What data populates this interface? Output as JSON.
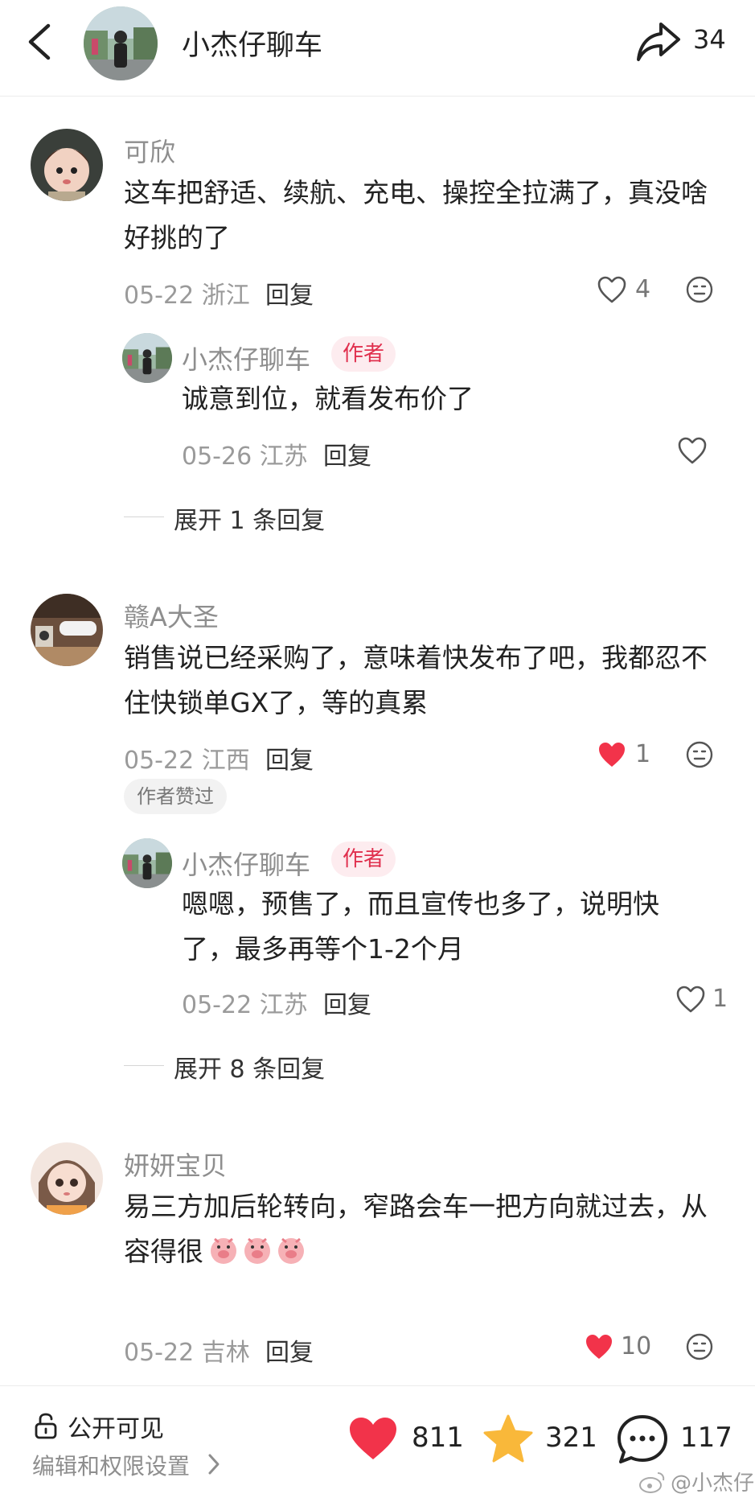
{
  "header": {
    "title": "小杰仔聊车",
    "share_count": "34"
  },
  "comments": [
    {
      "user": "可欣",
      "text": "这车把舒适、续航、充电、操控全拉满了，真没啥好挑的了",
      "date_loc": "05-22 浙江",
      "reply_label": "回复",
      "likes": "4",
      "liked": false,
      "reply": {
        "user": "小杰仔聊车",
        "author_tag": "作者",
        "text": "诚意到位，就看发布价了",
        "date_loc": "05-26 江苏",
        "reply_label": "回复",
        "likes": ""
      },
      "expand": "展开 1 条回复"
    },
    {
      "user": "赣A大圣",
      "text": "销售说已经采购了，意味着快发布了吧，我都忍不住快锁单GX了，等的真累",
      "date_loc": "05-22 江西",
      "reply_label": "回复",
      "likes": "1",
      "liked": true,
      "liked_by_author": "作者赞过",
      "reply": {
        "user": "小杰仔聊车",
        "author_tag": "作者",
        "text": "嗯嗯，预售了，而且宣传也多了，说明快了，最多再等个1-2个月",
        "date_loc": "05-22 江苏",
        "reply_label": "回复",
        "likes": "1"
      },
      "expand": "展开 8 条回复"
    },
    {
      "user": "妍妍宝贝",
      "text": "易三方加后轮转向，窄路会车一把方向就过去，从容得很",
      "date_loc": "05-22 吉林",
      "reply_label": "回复",
      "likes": "10",
      "liked": true
    }
  ],
  "footer": {
    "public": "公开可见",
    "permissions": "编辑和权限设置",
    "likes": "811",
    "favorites": "321",
    "comments": "117",
    "watermark": "@小杰仔"
  },
  "colors": {
    "like_red": "#f2334a",
    "star_yellow": "#f9b83a",
    "author_tag_bg": "#fdecef",
    "author_tag_fg": "#e0304e"
  }
}
